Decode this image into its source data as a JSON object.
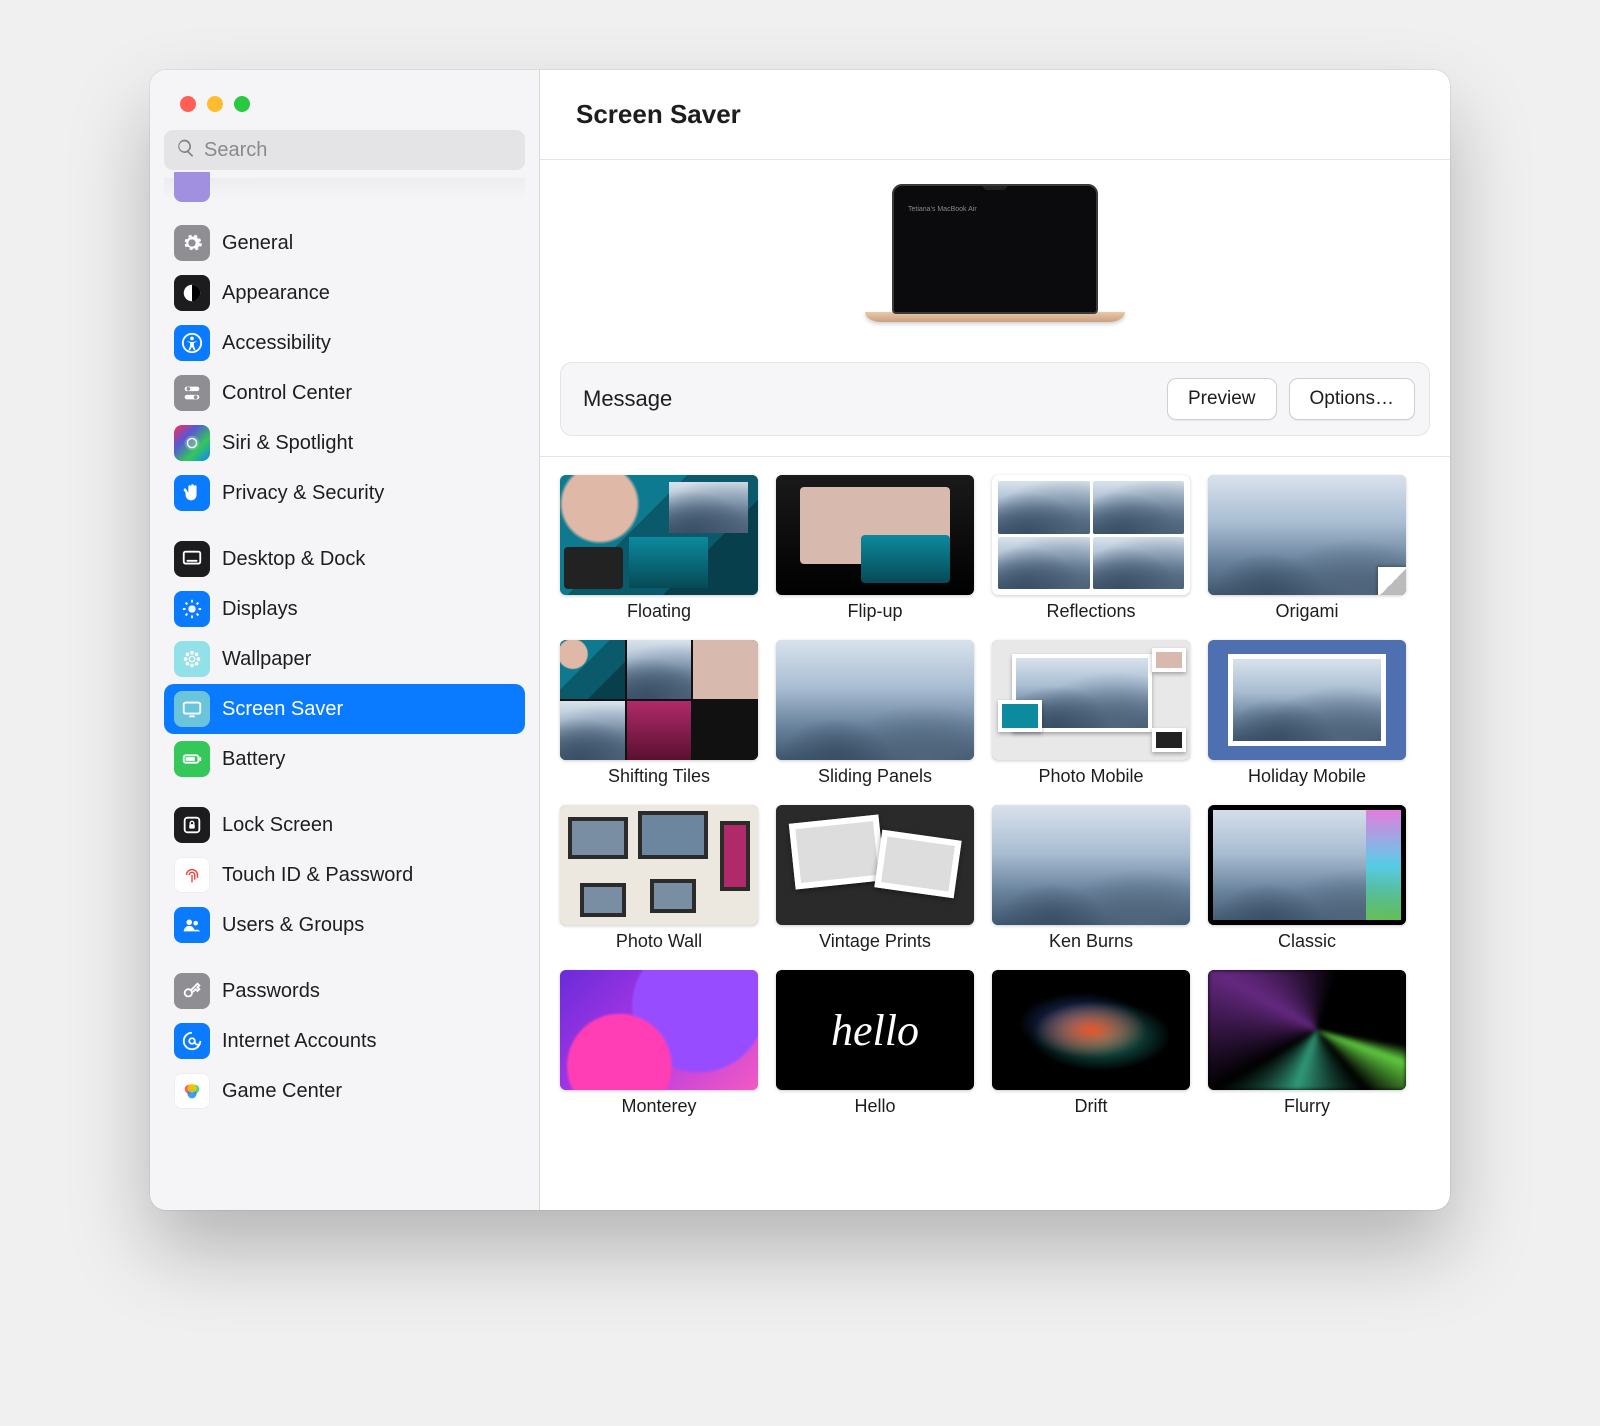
{
  "window": {
    "title": "Screen Saver"
  },
  "search": {
    "placeholder": "Search"
  },
  "sidebar": {
    "groups": [
      {
        "items": [
          {
            "label": "General",
            "icon": "gear",
            "color": "gray"
          },
          {
            "label": "Appearance",
            "icon": "appearance",
            "color": "black"
          },
          {
            "label": "Accessibility",
            "icon": "accessibility",
            "color": "blue"
          },
          {
            "label": "Control Center",
            "icon": "control-center",
            "color": "gray"
          },
          {
            "label": "Siri & Spotlight",
            "icon": "siri",
            "color": "siri"
          },
          {
            "label": "Privacy & Security",
            "icon": "hand",
            "color": "blue"
          }
        ]
      },
      {
        "items": [
          {
            "label": "Desktop & Dock",
            "icon": "dock",
            "color": "black"
          },
          {
            "label": "Displays",
            "icon": "displays",
            "color": "blue"
          },
          {
            "label": "Wallpaper",
            "icon": "wallpaper",
            "color": "cyan"
          },
          {
            "label": "Screen Saver",
            "icon": "screensaver",
            "color": "lightblue",
            "selected": true
          },
          {
            "label": "Battery",
            "icon": "battery",
            "color": "green"
          }
        ]
      },
      {
        "items": [
          {
            "label": "Lock Screen",
            "icon": "lock",
            "color": "black"
          },
          {
            "label": "Touch ID & Password",
            "icon": "fingerprint",
            "color": "red-fp"
          },
          {
            "label": "Users & Groups",
            "icon": "users",
            "color": "blue"
          }
        ]
      },
      {
        "items": [
          {
            "label": "Passwords",
            "icon": "key",
            "color": "gray"
          },
          {
            "label": "Internet Accounts",
            "icon": "at",
            "color": "at"
          },
          {
            "label": "Game Center",
            "icon": "gamecenter",
            "color": "gc"
          }
        ]
      }
    ]
  },
  "preview": {
    "message": "Tetiana's MacBook Air"
  },
  "toolbar": {
    "current_label": "Message",
    "preview_button": "Preview",
    "options_button": "Options…"
  },
  "screensavers": [
    {
      "label": "Floating",
      "art": "floating"
    },
    {
      "label": "Flip-up",
      "art": "flipup"
    },
    {
      "label": "Reflections",
      "art": "reflections"
    },
    {
      "label": "Origami",
      "art": "origami"
    },
    {
      "label": "Shifting Tiles",
      "art": "shifting"
    },
    {
      "label": "Sliding Panels",
      "art": "sliding"
    },
    {
      "label": "Photo Mobile",
      "art": "photomobile"
    },
    {
      "label": "Holiday Mobile",
      "art": "holiday"
    },
    {
      "label": "Photo Wall",
      "art": "photowall"
    },
    {
      "label": "Vintage Prints",
      "art": "vintage"
    },
    {
      "label": "Ken Burns",
      "art": "kenburns"
    },
    {
      "label": "Classic",
      "art": "classic"
    },
    {
      "label": "Monterey",
      "art": "monterey"
    },
    {
      "label": "Hello",
      "art": "hello"
    },
    {
      "label": "Drift",
      "art": "drift"
    },
    {
      "label": "Flurry",
      "art": "flurry"
    }
  ]
}
